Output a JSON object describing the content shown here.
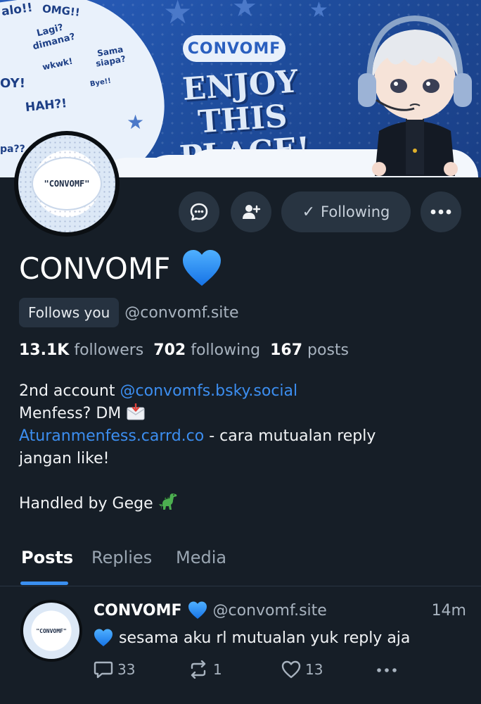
{
  "banner": {
    "brand_pill": "CONVOMF",
    "headline_line1": "ENJOY THIS",
    "headline_line2": "PLACE!",
    "doodles": [
      "alo!!",
      "OMG!!",
      "Lagi?",
      "dimana?",
      "Sama",
      "siapa?",
      "OY!",
      "wkwk!",
      "HAH?!",
      "pa??",
      "Bye!!"
    ]
  },
  "avatar": {
    "text": "\"CONVOMF\""
  },
  "actions": {
    "follow_label": "Following"
  },
  "profile": {
    "display_name": "CONVOMF",
    "follows_you": "Follows you",
    "handle": "@convomf.site",
    "stats": {
      "followers_count": "13.1K",
      "followers_label": "followers",
      "following_count": "702",
      "following_label": "following",
      "posts_count": "167",
      "posts_label": "posts"
    },
    "bio": {
      "line1_text": "2nd account ",
      "line1_link": "@convomfs.bsky.social",
      "line2_text": "Menfess? DM",
      "line3_link": "Aturanmenfess.carrd.co",
      "line3_text": " - cara mutualan reply",
      "line4_text": "jangan like!",
      "line5_text": "Handled by Gege"
    }
  },
  "tabs": [
    "Posts",
    "Replies",
    "Media"
  ],
  "post": {
    "avatar_text": "\"CONVOMF\"",
    "author": "CONVOMF",
    "handle": "@convomf.site",
    "time": "14m",
    "text": "sesama aku rl mutualan yuk reply aja",
    "replies": "33",
    "reposts": "1",
    "likes": "13"
  },
  "colors": {
    "background": "#161e27",
    "link": "#3c8ef0",
    "heart": "#1e8cff",
    "tab_underline": "#3a8ff0"
  }
}
